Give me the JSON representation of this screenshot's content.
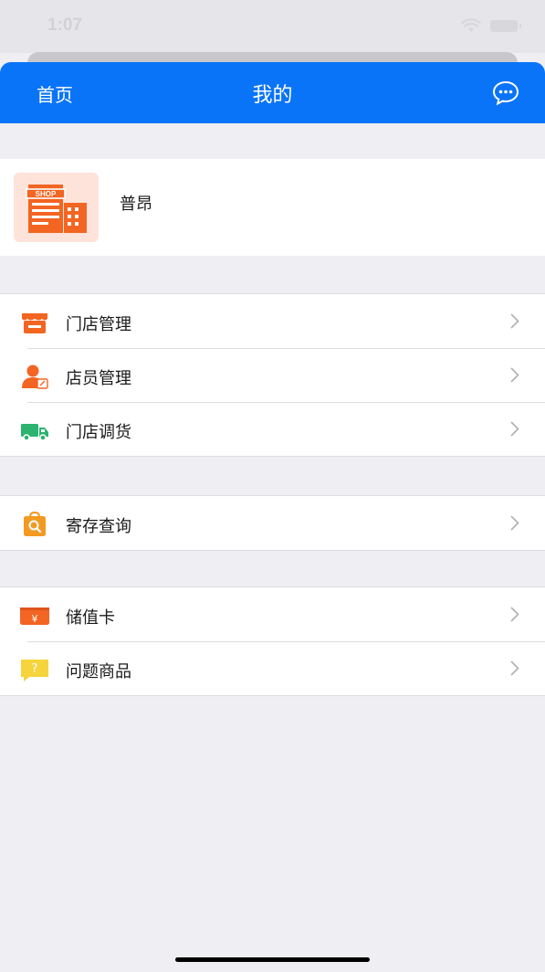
{
  "status_bar": {
    "time": "1:07"
  },
  "nav": {
    "back_label": "首页",
    "title": "我的"
  },
  "profile": {
    "shop_name": "普昂",
    "logo_text": "SHOP"
  },
  "groups": [
    [
      {
        "label": "门店管理",
        "icon": "storefront-icon"
      },
      {
        "label": "店员管理",
        "icon": "staff-icon"
      },
      {
        "label": "门店调货",
        "icon": "delivery-truck-icon"
      }
    ],
    [
      {
        "label": "寄存查询",
        "icon": "storage-search-icon"
      }
    ],
    [
      {
        "label": "储值卡",
        "icon": "stored-value-card-icon",
        "icon_text": "¥"
      },
      {
        "label": "问题商品",
        "icon": "question-product-icon",
        "icon_text": "?"
      }
    ]
  ],
  "colors": {
    "nav_blue": "#0a74f8",
    "orange": "#f26522",
    "green": "#2bb36f",
    "yellow": "#f5d43c"
  }
}
